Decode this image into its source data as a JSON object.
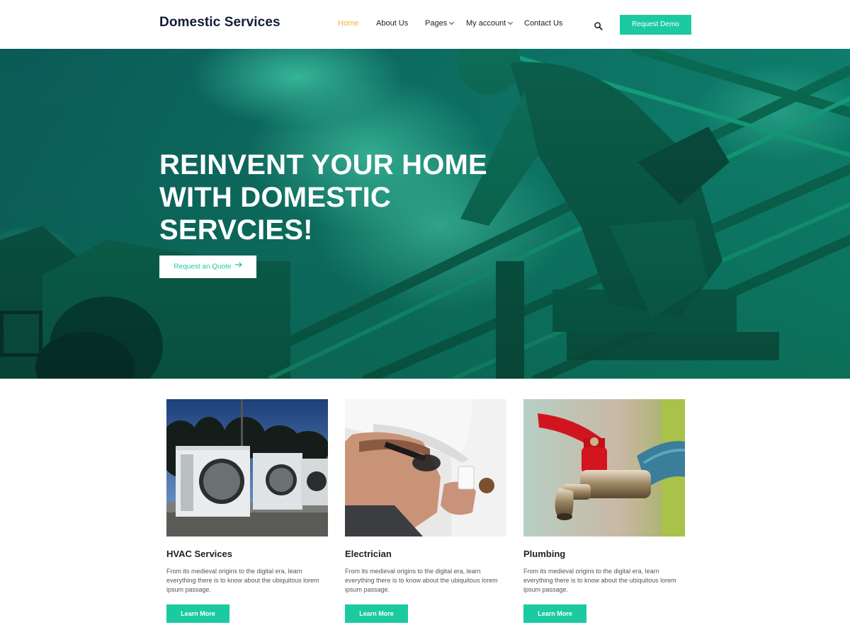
{
  "header": {
    "logo": "Domestic Services",
    "nav": [
      {
        "label": "Home",
        "active": true
      },
      {
        "label": "About Us",
        "active": false
      },
      {
        "label": "Pages",
        "active": false,
        "dropdown": true
      },
      {
        "label": "My account",
        "active": false,
        "dropdown": true
      },
      {
        "label": "Contact Us",
        "active": false
      }
    ],
    "search_icon": "search-icon",
    "demo_button": "Request Demo"
  },
  "hero": {
    "title": "REINVENT YOUR HOME WITH DOMESTIC SERVCIES!",
    "quote_button": "Request an Quote",
    "quote_icon": "arrow-right-icon"
  },
  "services": [
    {
      "title": "HVAC Services",
      "text": "From its medieval origins to the digital era, learn everything there is to know about the ubiquitous lorem ipsum passage.",
      "button": "Learn More",
      "image": "air-conditioner-units-photo"
    },
    {
      "title": "Electrician",
      "text": "From its medieval origins to the digital era, learn everything there is to know about the ubiquitous lorem ipsum passage.",
      "button": "Learn More",
      "image": "electrician-photo"
    },
    {
      "title": "Plumbing",
      "text": "From its medieval origins to the digital era, learn everything there is to know about the ubiquitous lorem ipsum passage.",
      "button": "Learn More",
      "image": "faucet-valve-photo"
    }
  ],
  "colors": {
    "accent": "#1ccaa1",
    "active_nav": "#f0b537",
    "logo": "#111d3a"
  }
}
